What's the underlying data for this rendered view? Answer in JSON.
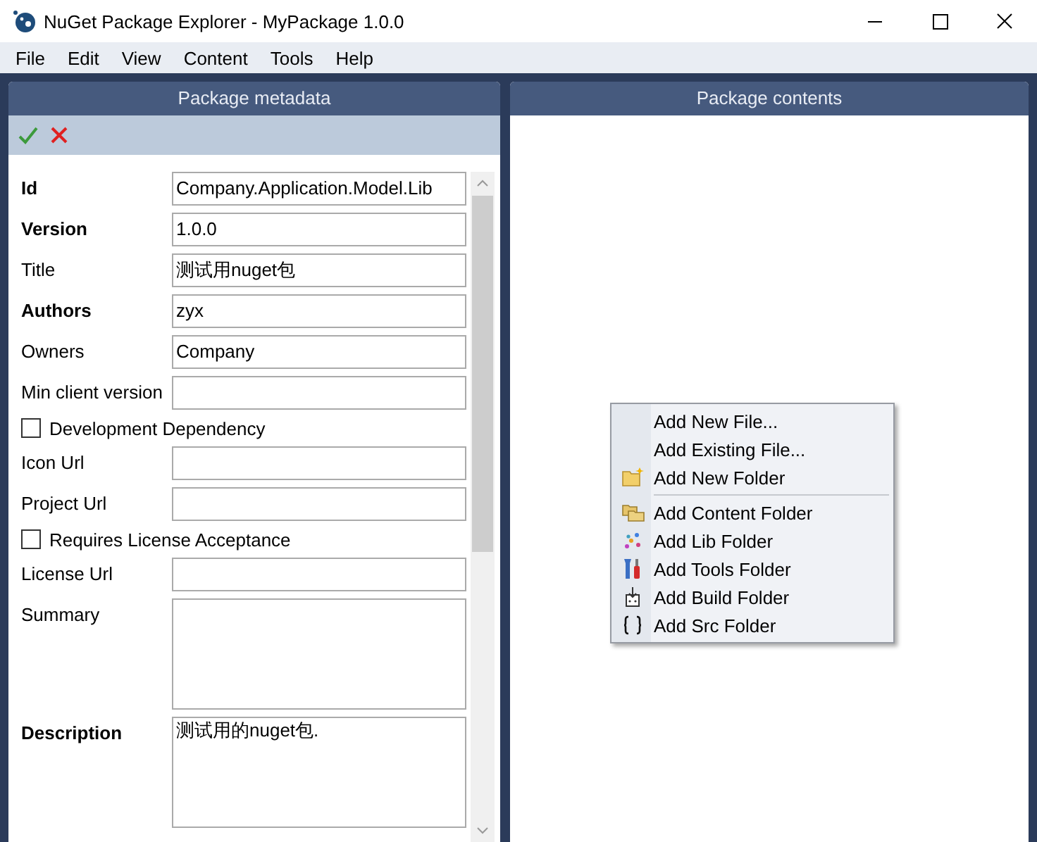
{
  "window": {
    "title": "NuGet Package Explorer - MyPackage 1.0.0"
  },
  "menu": [
    "File",
    "Edit",
    "View",
    "Content",
    "Tools",
    "Help"
  ],
  "metadata_panel": {
    "title": "Package metadata",
    "fields": [
      {
        "kind": "text",
        "label": "Id",
        "required": true,
        "value": "Company.Application.Model.Lib"
      },
      {
        "kind": "text",
        "label": "Version",
        "required": true,
        "value": "1.0.0"
      },
      {
        "kind": "text",
        "label": "Title",
        "required": false,
        "value": "测试用nuget包"
      },
      {
        "kind": "text",
        "label": "Authors",
        "required": true,
        "value": "zyx"
      },
      {
        "kind": "text",
        "label": "Owners",
        "required": false,
        "value": "Company"
      },
      {
        "kind": "text",
        "label": "Min client version",
        "required": false
      },
      {
        "kind": "checkbox",
        "label": "Development Dependency",
        "checked": false
      },
      {
        "kind": "text",
        "label": "Icon Url",
        "required": false
      },
      {
        "kind": "text",
        "label": "Project Url",
        "required": false
      },
      {
        "kind": "checkbox",
        "label": "Requires License Acceptance",
        "checked": false
      },
      {
        "kind": "text",
        "label": "License Url",
        "required": false
      },
      {
        "kind": "textarea",
        "label": "Summary",
        "required": false
      },
      {
        "kind": "textarea",
        "label": "Description",
        "required": true,
        "value": "测试用的nuget包."
      }
    ]
  },
  "contents_panel": {
    "title": "Package contents"
  },
  "context_menu": [
    {
      "kind": "item",
      "label": "Add New File..."
    },
    {
      "kind": "item",
      "label": "Add Existing File..."
    },
    {
      "kind": "item",
      "label": "Add New Folder"
    },
    {
      "kind": "separator"
    },
    {
      "kind": "item",
      "label": "Add Content Folder"
    },
    {
      "kind": "item",
      "label": "Add Lib Folder"
    },
    {
      "kind": "item",
      "label": "Add Tools Folder"
    },
    {
      "kind": "item",
      "label": "Add Build Folder"
    },
    {
      "kind": "item",
      "label": "Add Src Folder"
    }
  ]
}
